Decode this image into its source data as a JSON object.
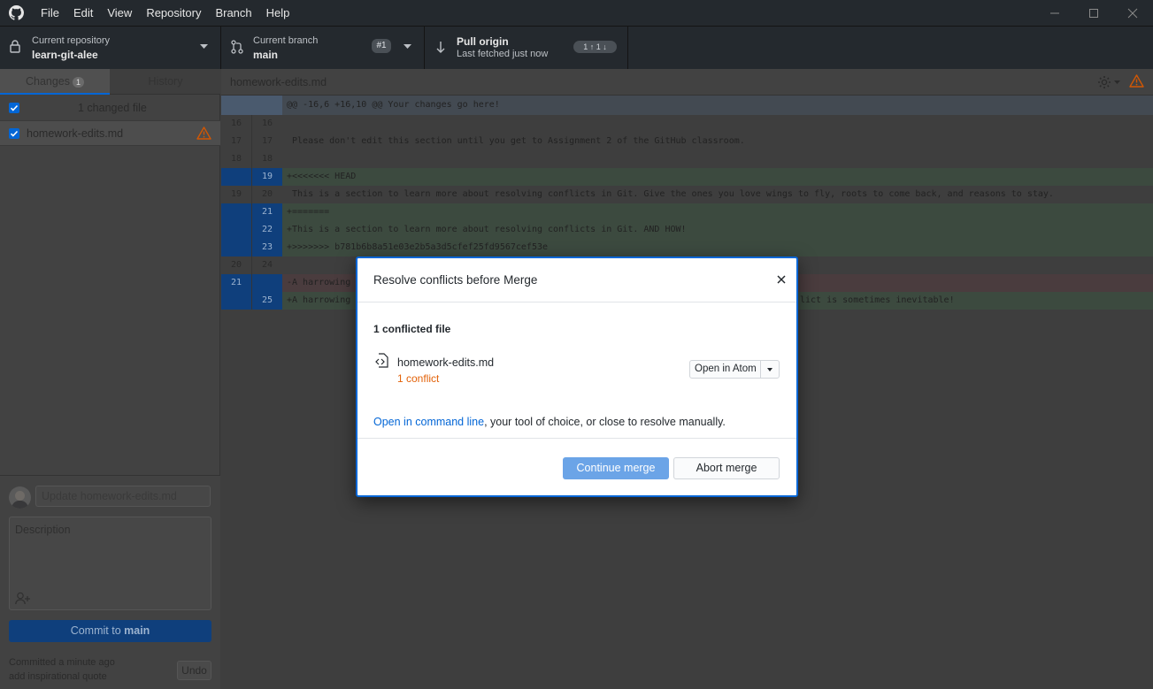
{
  "menu": [
    "File",
    "Edit",
    "View",
    "Repository",
    "Branch",
    "Help"
  ],
  "toolbar": {
    "repo_title": "Current repository",
    "repo_value": "learn-git-alee",
    "branch_title": "Current branch",
    "branch_value": "main",
    "pr_badge": "#1",
    "pull_title": "Pull origin",
    "pull_subtitle": "Last fetched just now",
    "ahead_behind": "1 ↑ 1 ↓"
  },
  "sidebar": {
    "tab_changes": "Changes",
    "tab_changes_count": "1",
    "tab_history": "History",
    "changed_files_label": "1 changed file",
    "file_name": "homework-edits.md",
    "summary_placeholder": "Update homework-edits.md",
    "description_placeholder": "Description",
    "commit_prefix": "Commit to ",
    "commit_branch": "main",
    "last_commit_time": "Committed a minute ago",
    "last_commit_msg": "add inspirational quote",
    "undo_label": "Undo"
  },
  "main": {
    "file_header": "homework-edits.md",
    "diff": [
      {
        "old": "",
        "new": "",
        "text": "@@ -16,6 +16,10 @@ Your changes go here!",
        "kind": "hunk"
      },
      {
        "old": "16",
        "new": "16",
        "text": " ",
        "kind": "ctx"
      },
      {
        "old": "17",
        "new": "17",
        "text": " Please don't edit this section until you get to Assignment 2 of the GitHub classroom.",
        "kind": "ctx"
      },
      {
        "old": "18",
        "new": "18",
        "text": " ",
        "kind": "ctx"
      },
      {
        "old": "",
        "new": "19",
        "text": "+<<<<<<< HEAD",
        "kind": "add"
      },
      {
        "old": "19",
        "new": "20",
        "text": " This is a section to learn more about resolving conflicts in Git. Give the ones you love wings to fly, roots to come back, and reasons to stay.",
        "kind": "ctx"
      },
      {
        "old": "",
        "new": "21",
        "text": "+=======",
        "kind": "add"
      },
      {
        "old": "",
        "new": "22",
        "text": "+This is a section to learn more about resolving conflicts in Git. AND HOW!",
        "kind": "add"
      },
      {
        "old": "",
        "new": "23",
        "text": "+>>>>>>> b781b6b8a51e03e2b5a3d5cfef25fd9567cef53e",
        "kind": "add"
      },
      {
        "old": "20",
        "new": "24",
        "text": " ",
        "kind": "ctx"
      },
      {
        "old": "21",
        "new": "",
        "text": "-A harrowing",
        "kind": "del"
      },
      {
        "old": "",
        "new": "25",
        "text": "+A harrowing",
        "kind": "add",
        "tail": "lict is sometimes inevitable!"
      }
    ]
  },
  "dialog": {
    "title": "Resolve conflicts before Merge",
    "count_label": "1 conflicted file",
    "file_name": "homework-edits.md",
    "conflict_label": "1 conflict",
    "open_button": "Open in Atom",
    "hint_link": "Open in command line",
    "hint_rest": ", your tool of choice, or close to resolve manually.",
    "continue_label": "Continue merge",
    "abort_label": "Abort merge"
  },
  "colors": {
    "accent": "#0366d6",
    "conflict": "#e36209",
    "added_bg": "#3c4a3f",
    "removed_bg": "#4a3c3e"
  }
}
